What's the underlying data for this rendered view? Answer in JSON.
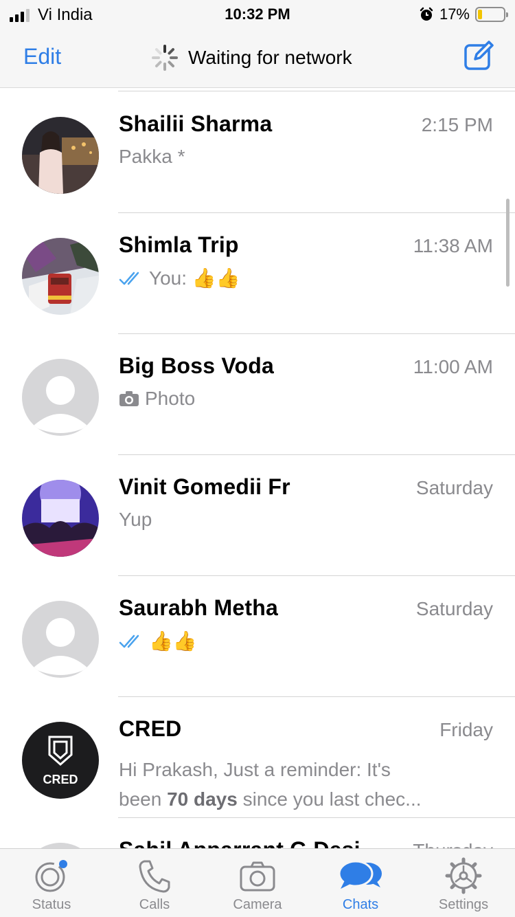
{
  "status_bar": {
    "carrier": "Vi India",
    "time": "10:32 PM",
    "battery": "17%",
    "battery_level": 0.17
  },
  "nav": {
    "edit_label": "Edit",
    "title": "Waiting for network"
  },
  "chats": [
    {
      "name": "Shailii Sharma",
      "time": "2:15 PM",
      "preview": "Pakka *",
      "avatar": "photo"
    },
    {
      "name": "Shimla Trip",
      "time": "11:38 AM",
      "preview": "You: 👍👍",
      "avatar": "photo",
      "read_ticks": true
    },
    {
      "name": "Big Boss Voda",
      "time": "11:00 AM",
      "preview": "Photo",
      "avatar": "placeholder",
      "camera_icon": true
    },
    {
      "name": "Vinit Gomedii Fr",
      "time": "Saturday",
      "preview": "Yup",
      "avatar": "photo"
    },
    {
      "name": "Saurabh Metha",
      "time": "Saturday",
      "preview": "👍👍",
      "avatar": "placeholder",
      "read_ticks": true
    },
    {
      "name": "CRED",
      "time": "Friday",
      "preview_line1": "Hi Prakash, Just a reminder: It's",
      "preview_pre": "been ",
      "preview_bold": "70 days",
      "preview_post": " since you last chec...",
      "avatar": "logo",
      "logo_text": "CRED"
    },
    {
      "name": "Sahil Apparrant G Desi",
      "time": "Thursday",
      "avatar": "placeholder"
    }
  ],
  "tabs": [
    {
      "label": "Status",
      "icon": "status-icon"
    },
    {
      "label": "Calls",
      "icon": "phone-icon"
    },
    {
      "label": "Camera",
      "icon": "camera-icon"
    },
    {
      "label": "Chats",
      "icon": "chats-icon",
      "active": true
    },
    {
      "label": "Settings",
      "icon": "gear-icon"
    }
  ],
  "colors": {
    "accent": "#2f7ee6",
    "secondary_text": "#8a8a8e",
    "bar_background": "#f6f6f6"
  }
}
